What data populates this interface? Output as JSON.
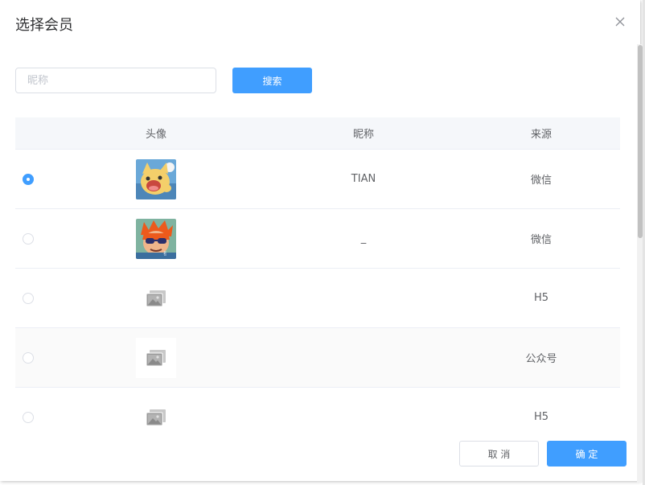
{
  "dialog": {
    "title": "选择会员",
    "close_icon": "close-icon"
  },
  "search": {
    "placeholder": "昵称",
    "value": "",
    "button_label": "搜索"
  },
  "table": {
    "columns": [
      "头像",
      "昵称",
      "来源"
    ],
    "rows": [
      {
        "selected": true,
        "avatar": "cartoon-fox-avatar",
        "nickname": "TIAN",
        "source": "微信"
      },
      {
        "selected": false,
        "avatar": "cartoon-boy-avatar",
        "nickname": "_",
        "source": "微信"
      },
      {
        "selected": false,
        "avatar": "image-placeholder-icon",
        "nickname": "",
        "source": "H5"
      },
      {
        "selected": false,
        "avatar": "image-placeholder-icon",
        "nickname": "",
        "source": "公众号"
      },
      {
        "selected": false,
        "avatar": "image-placeholder-icon",
        "nickname": "",
        "source": "H5"
      }
    ]
  },
  "footer": {
    "cancel_label": "取 消",
    "confirm_label": "确 定"
  },
  "colors": {
    "primary": "#409eff",
    "header_bg": "#f5f7fa",
    "border": "#ebeef5"
  }
}
